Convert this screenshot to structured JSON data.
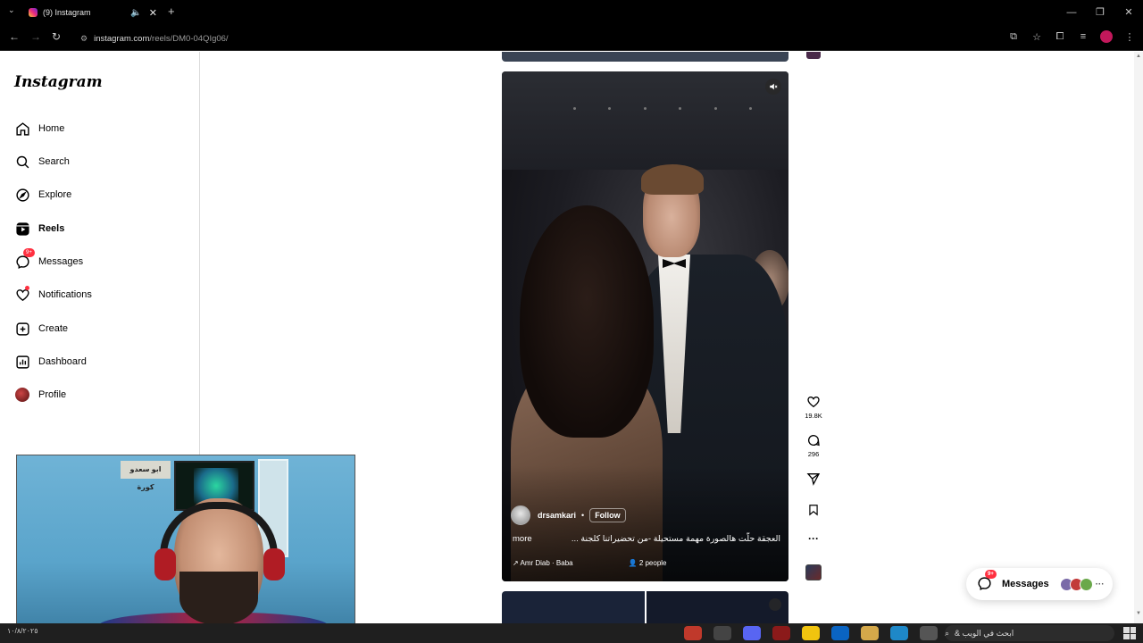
{
  "browser": {
    "tab_title": "(9) Instagram",
    "url_host": "instagram.com",
    "url_path": "/reels/DM0-04QIg06/"
  },
  "sidebar": {
    "logo": "Instagram",
    "items": [
      {
        "label": "Home",
        "icon": "home-icon"
      },
      {
        "label": "Search",
        "icon": "search-icon"
      },
      {
        "label": "Explore",
        "icon": "compass-icon"
      },
      {
        "label": "Reels",
        "icon": "reels-icon"
      },
      {
        "label": "Messages",
        "icon": "messenger-icon",
        "badge": "9+"
      },
      {
        "label": "Notifications",
        "icon": "heart-icon"
      },
      {
        "label": "Create",
        "icon": "plus-square-icon"
      },
      {
        "label": "Dashboard",
        "icon": "chart-icon"
      },
      {
        "label": "Profile",
        "icon": "avatar"
      }
    ]
  },
  "reel": {
    "author": "drsamkari",
    "separator": "•",
    "follow_label": "Follow",
    "caption": "العجقة حلّت هالصورة مهمة مستحيلة -من تحضيراتنا كلجنة ...",
    "more_label": "more",
    "audio": "Amr Diab · Baba",
    "tagged": "2 people"
  },
  "actions": {
    "likes": "19.8K",
    "comments": "296"
  },
  "messages_pill": {
    "label": "Messages",
    "badge": "9+",
    "more": "···"
  },
  "webcam": {
    "poster_text": "ابو سعدو كورة"
  },
  "taskbar": {
    "date": "١٠/٨/٢٠٢٥",
    "search_text": "ابحث في الويب &"
  },
  "colors": {
    "accent_badge": "#ff3040",
    "sidebar_border": "#dbdbdb"
  }
}
